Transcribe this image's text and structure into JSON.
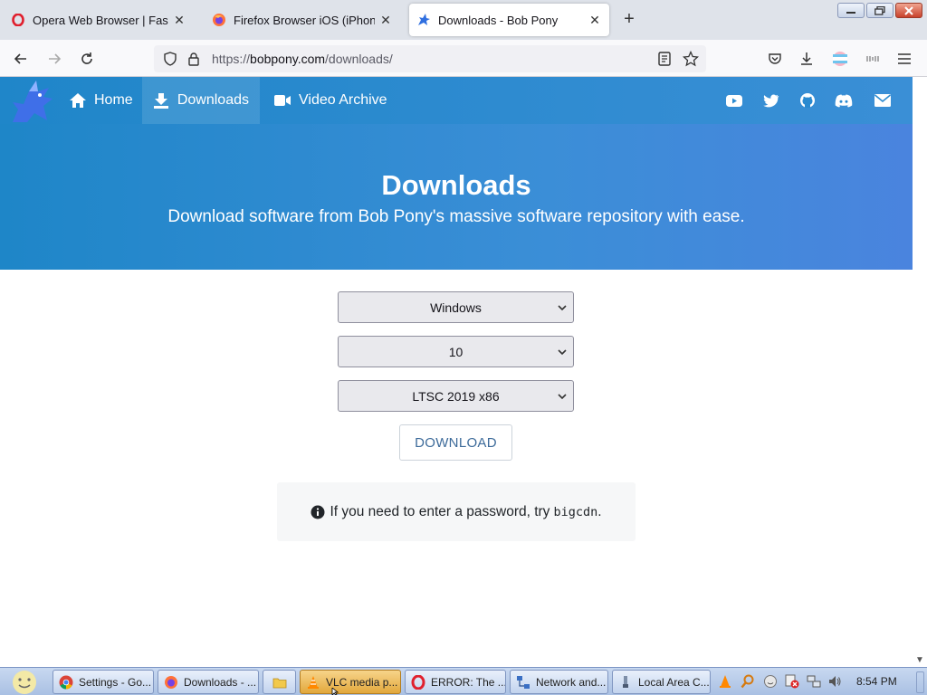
{
  "browser": {
    "tabs": [
      {
        "title": "Opera Web Browser | Faster, Saf",
        "icon": "opera-icon"
      },
      {
        "title": "Firefox Browser iOS (iPhone & i",
        "icon": "firefox-icon"
      },
      {
        "title": "Downloads - Bob Pony",
        "icon": "bobpony-icon",
        "active": true
      }
    ],
    "url_scheme": "https://",
    "url_host": "bobpony.com",
    "url_path": "/downloads/"
  },
  "site": {
    "nav": {
      "home": "Home",
      "downloads": "Downloads",
      "video_archive": "Video Archive"
    },
    "social_icons": [
      "youtube-icon",
      "twitter-icon",
      "github-icon",
      "discord-icon",
      "email-icon"
    ],
    "hero": {
      "title": "Downloads",
      "subtitle": "Download software from Bob Pony's massive software repository with ease."
    },
    "selects": {
      "os": "Windows",
      "version": "10",
      "edition": "LTSC 2019 x86"
    },
    "download_button": "DOWNLOAD",
    "notice": {
      "text": "If you need to enter a password, try",
      "password": "bigcdn",
      "end": "."
    },
    "colors": {
      "brand": "#2a8ad0"
    }
  },
  "taskbar": {
    "items": [
      {
        "label": "Settings - Go...",
        "icon": "chrome-icon"
      },
      {
        "label": "Downloads - ...",
        "icon": "firefox-icon"
      },
      {
        "label": "",
        "icon": "folder-icon"
      },
      {
        "label": "VLC media p...",
        "icon": "vlc-icon",
        "active": true
      },
      {
        "label": "ERROR: The ...",
        "icon": "opera-icon"
      },
      {
        "label": "Network and...",
        "icon": "network-icon"
      },
      {
        "label": "Local Area C...",
        "icon": "network-adapter-icon"
      }
    ],
    "clock": "8:54 PM"
  }
}
